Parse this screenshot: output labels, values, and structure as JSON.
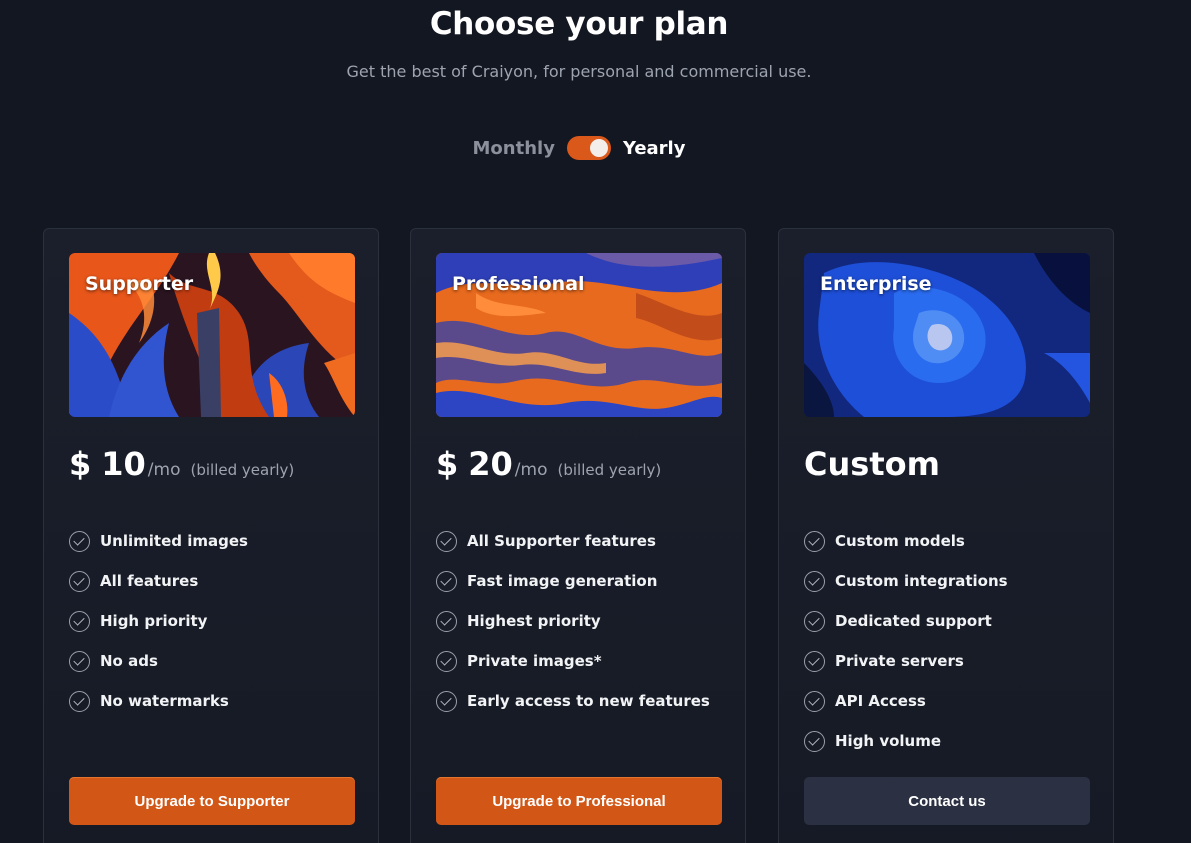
{
  "header": {
    "title": "Choose your plan",
    "subtitle": "Get the best of Craiyon, for personal and commercial use."
  },
  "billing": {
    "monthly_label": "Monthly",
    "yearly_label": "Yearly",
    "selected": "Yearly"
  },
  "colors": {
    "accent": "#d25717",
    "background": "#131722",
    "card": "#1b1f2b",
    "secondary_button": "#2b3142"
  },
  "plans": [
    {
      "name": "Supporter",
      "currency": "$",
      "price": "10",
      "period": "/mo",
      "billing_note": "(billed yearly)",
      "features": [
        "Unlimited images",
        "All features",
        "High priority",
        "No ads",
        "No watermarks"
      ],
      "cta": "Upgrade to Supporter"
    },
    {
      "name": "Professional",
      "currency": "$",
      "price": "20",
      "period": "/mo",
      "billing_note": "(billed yearly)",
      "features": [
        "All Supporter features",
        "Fast image generation",
        "Highest priority",
        "Private images*",
        "Early access to new features"
      ],
      "cta": "Upgrade to Professional"
    },
    {
      "name": "Enterprise",
      "price_label": "Custom",
      "features": [
        "Custom models",
        "Custom integrations",
        "Dedicated support",
        "Private servers",
        "API Access",
        "High volume"
      ],
      "cta": "Contact us"
    }
  ]
}
